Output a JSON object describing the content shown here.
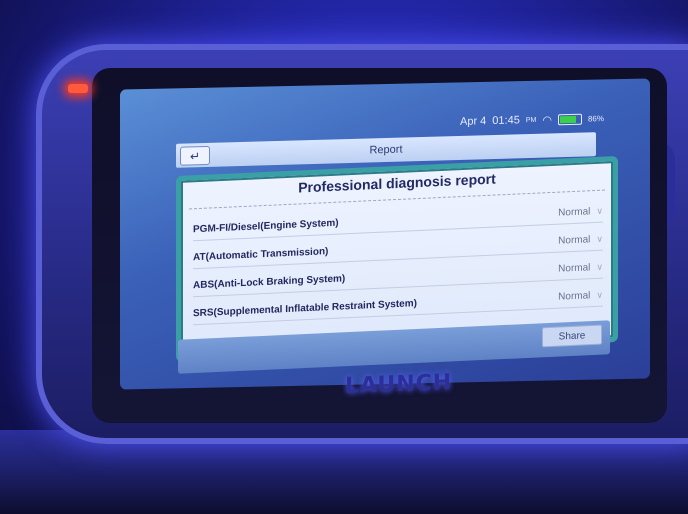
{
  "status": {
    "date": "Apr 4",
    "time": "01:45",
    "ampm": "PM",
    "battery": "86%"
  },
  "header": {
    "title": "Report"
  },
  "report": {
    "title": "Professional diagnosis report",
    "items": [
      {
        "name": "PGM-FI/Diesel(Engine System)",
        "status": "Normal"
      },
      {
        "name": "AT(Automatic Transmission)",
        "status": "Normal"
      },
      {
        "name": "ABS(Anti-Lock Braking System)",
        "status": "Normal"
      },
      {
        "name": "SRS(Supplemental Inflatable Restraint System)",
        "status": "Normal"
      }
    ]
  },
  "footer": {
    "share_label": "Share"
  },
  "device": {
    "brand": "LAUNCH"
  },
  "colors": {
    "accent": "#3b9fa6",
    "panel_bg": "#eef3ff",
    "led": "#ff5a3c"
  }
}
